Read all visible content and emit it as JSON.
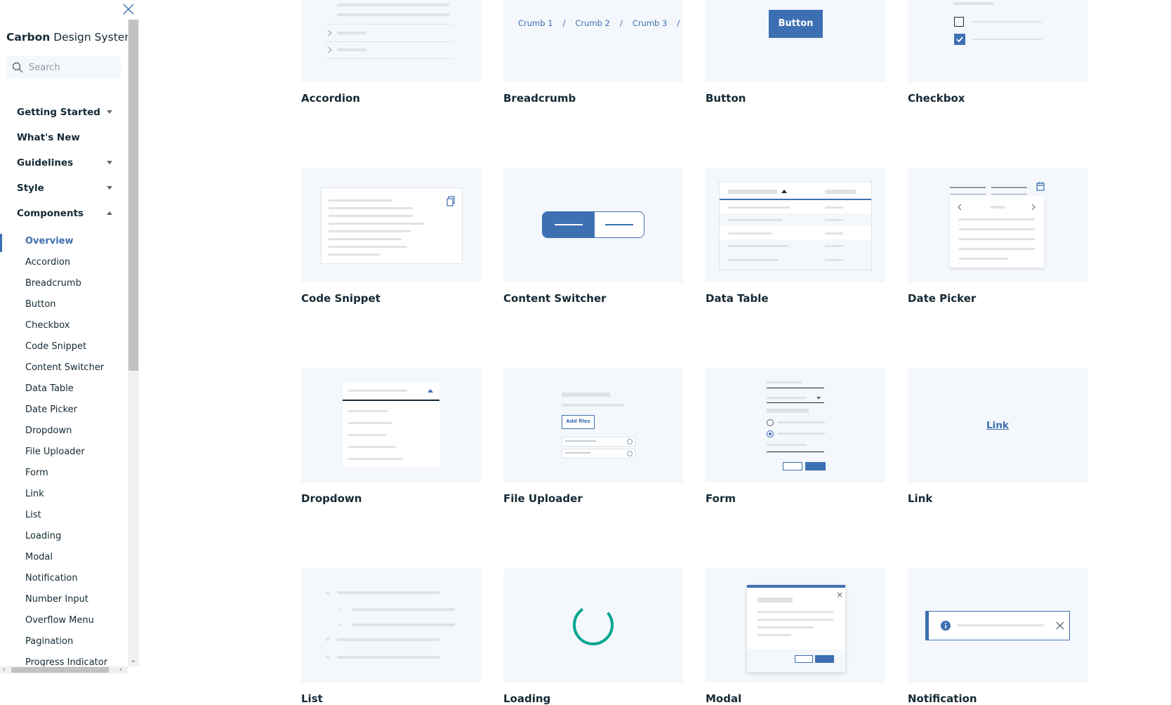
{
  "sidebar": {
    "brand_bold": "Carbon",
    "brand_rest": " Design System",
    "search_placeholder": "Search",
    "sections": [
      {
        "label": "Getting Started"
      },
      {
        "label": "What's New"
      },
      {
        "label": "Guidelines"
      },
      {
        "label": "Style"
      },
      {
        "label": "Components"
      }
    ],
    "component_items": [
      {
        "label": "Overview"
      },
      {
        "label": "Accordion"
      },
      {
        "label": "Breadcrumb"
      },
      {
        "label": "Button"
      },
      {
        "label": "Checkbox"
      },
      {
        "label": "Code Snippet"
      },
      {
        "label": "Content Switcher"
      },
      {
        "label": "Data Table"
      },
      {
        "label": "Date Picker"
      },
      {
        "label": "Dropdown"
      },
      {
        "label": "File Uploader"
      },
      {
        "label": "Form"
      },
      {
        "label": "Link"
      },
      {
        "label": "List"
      },
      {
        "label": "Loading"
      },
      {
        "label": "Modal"
      },
      {
        "label": "Notification"
      },
      {
        "label": "Number Input"
      },
      {
        "label": "Overflow Menu"
      },
      {
        "label": "Pagination"
      },
      {
        "label": "Progress Indicator"
      }
    ]
  },
  "cards": [
    {
      "title": "Accordion"
    },
    {
      "title": "Breadcrumb",
      "crumbs": [
        "Crumb 1",
        "/",
        "Crumb 2",
        "/",
        "Crumb 3",
        "/"
      ]
    },
    {
      "title": "Button",
      "button_label": "Button"
    },
    {
      "title": "Checkbox"
    },
    {
      "title": "Code Snippet"
    },
    {
      "title": "Content Switcher"
    },
    {
      "title": "Data Table"
    },
    {
      "title": "Date Picker"
    },
    {
      "title": "Dropdown"
    },
    {
      "title": "File Uploader",
      "add_files_label": "Add files"
    },
    {
      "title": "Form"
    },
    {
      "title": "Link",
      "link_label": "Link"
    },
    {
      "title": "List"
    },
    {
      "title": "Loading"
    },
    {
      "title": "Modal"
    },
    {
      "title": "Notification"
    }
  ],
  "colors": {
    "accent": "#3d70b2",
    "text": "#152935",
    "tile_bg": "#f4f7fb",
    "loading": "#00a68f"
  }
}
